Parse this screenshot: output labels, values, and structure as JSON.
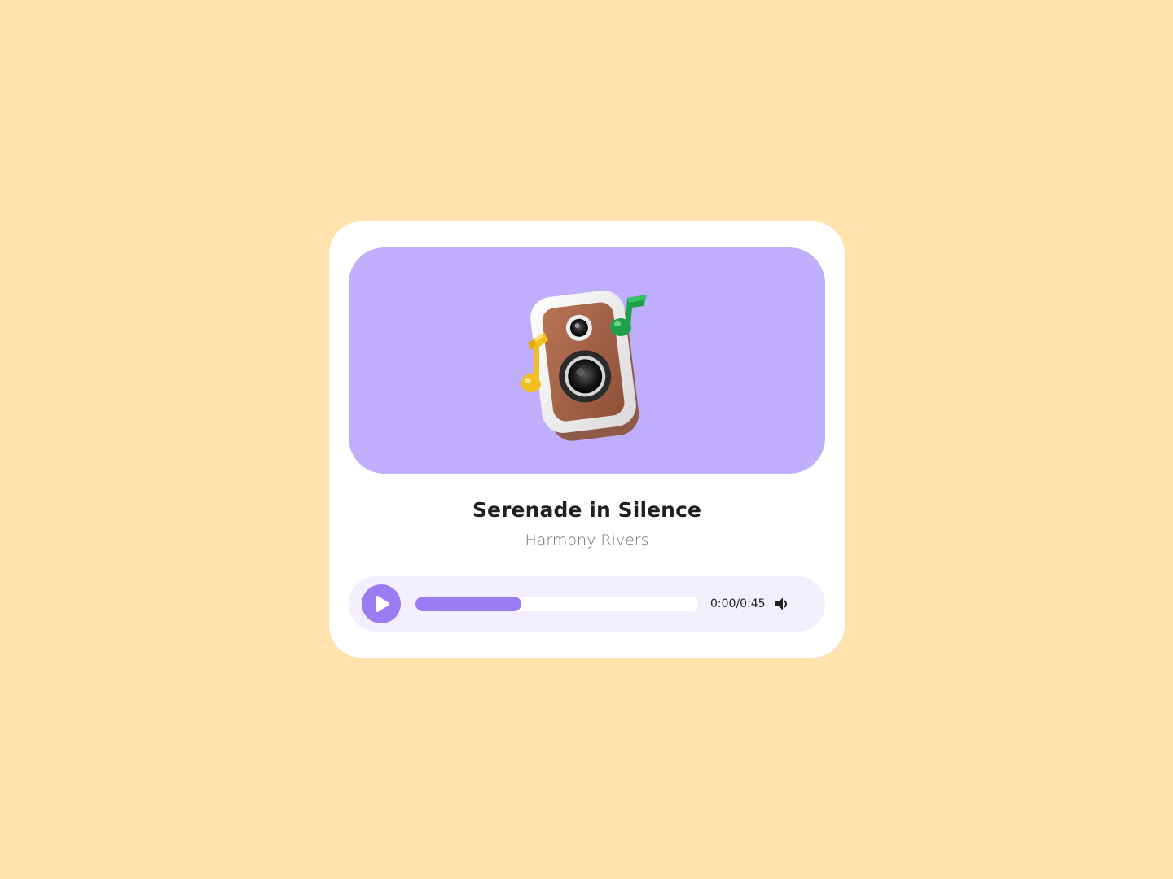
{
  "track": {
    "title": "Serenade in Silence",
    "artist": "Harmony Rivers",
    "artwork_icon": "speaker-with-music-notes-icon"
  },
  "player": {
    "play_icon": "play-icon",
    "volume_icon": "volume-icon",
    "time_display": "0:00/0:45",
    "progress_fraction": 0.375
  },
  "colors": {
    "background": "#FFE2AE",
    "card": "#FFFFFF",
    "artwork_bg": "#BFAEFC",
    "accent": "#9A7CF2",
    "player_bar_bg": "#F3EFFE",
    "title_text": "#1F1F24",
    "artist_text": "#707078"
  }
}
